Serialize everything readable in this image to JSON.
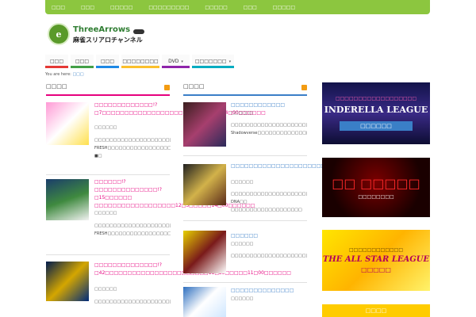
{
  "topnav": [
    "□□□",
    "□□□",
    "□□□□□",
    "□□□□□□□□□",
    "□□□□□",
    "□□□",
    "□□□□□"
  ],
  "logo": {
    "mark": "e",
    "name": "ThreeArrows",
    "sub": "麻雀スリアロチャンネル"
  },
  "mainnav": [
    {
      "label": "□□□",
      "color": "#e53935"
    },
    {
      "label": "□□□",
      "color": "#43a047"
    },
    {
      "label": "□□□",
      "color": "#1e88e5"
    },
    {
      "label": "□□□□□□□□",
      "color": "#fbc02d"
    },
    {
      "label": "DVD",
      "color": "#8e24aa",
      "caret": "▾"
    },
    {
      "label": "□□□□□□□",
      "color": "#00acc1",
      "caret": "▾"
    }
  ],
  "breadcrumb": {
    "prefix": "You are here:",
    "current": "□□□"
  },
  "colors": {
    "pink": "#e6007e",
    "blue": "#3a7fc7",
    "green": "#8cc63f",
    "rss": "#f39c12"
  },
  "left_column": {
    "heading": "□□□□",
    "posts": [
      {
        "title": "□□□□□□□□□□□□□!?□7□□□□□□□□□□□□□□□□□□□12□16□□□□14□00□□□□□□",
        "date": "□□□□□□",
        "excerpt": "□□□□□□□□□□□□□□□□□□□□□□□□□□□□□□□□□□□□□□□□□□□□□□□□□□□□□□□□□□□□□□ FRESH□□□□□□□□□□□□□□□□□□□□□□ ■□"
      },
      {
        "title": "□□□□□□!?□□□□□□□□□□□□□□!?□15□□□□□□ □□□□□□□□□□□□□□□□□□12□3□□□□□14□00□□□□□□",
        "date": "□□□□□□",
        "excerpt": "□□□□□□□□□□□□□□□□□□□□□□□□□□□□□□□□□□□□□□□□□□□□□□□□□□□□□□□□□□ FRESH□□□□□□□□□□□□□□□□□□"
      },
      {
        "title": "□□□□□□□□□□□□□□!?□42□□□□□□□□□□□□□□□□□□□□□□□11□23□□□□□11□00□□□□□□",
        "date": "□□□□□□",
        "excerpt": "□□□□□□□□□□□□□□□□□□□□□□□□□□□□□□□□□□□□□□□□□□□"
      }
    ]
  },
  "mid_column": {
    "heading": "□□□□",
    "posts": [
      {
        "title": "□□□□□□□□□□□□",
        "date": "□□□□□□",
        "excerpt": "□□□□□□□□□□□□□□□□□□□□□□□□□□□□□ Shadowverse□□□□□□□□□□□□□□□□□□□□□□□□□□□□□□□□□□□□□□□Shadowverse□□□□"
      },
      {
        "title": "□□□□□□□□□□□□□□□□□□□□□□□□□□□",
        "date": "□□□□□□",
        "excerpt": "□□□□□□□□□□□□□□□□□□□□□□□□□□□□□□□□□□□□□□□□□□□ DNA□□ □□□□□□□□□□□□□□□□□□□"
      },
      {
        "title": "□□□□□□",
        "date": "□□□□□□",
        "excerpt": "□□□□□□□□□□□□□□□□□□□□□□□□□□□□□□□□□□□□□□□□□□□□□□□□□□□□"
      },
      {
        "title": "□□□□□□□□□□□□□□",
        "date": "□□□□□□",
        "excerpt": ""
      }
    ]
  },
  "banners": [
    {
      "title": "INDERELLA LEAGUE",
      "sub": "□□□□□□□□□□□□□□□□□□",
      "cta": "□□□□□□",
      "bg": "#1a1a5e",
      "fg": "#ffffff"
    },
    {
      "title": "□□ □□□□□",
      "sub": "□□□□□□□□",
      "cta": "",
      "bg": "#3a0000",
      "fg": "#ff3333"
    },
    {
      "title": "THE ALL STAR LEAGUE",
      "sub": "□□□□□□□□□□□□",
      "cta": "□□□□□",
      "bg": "#f5d800",
      "fg": "#b3005a"
    },
    {
      "title": "□□□□",
      "sub": "",
      "cta": "",
      "bg": "#ffcc00",
      "fg": "#ffffff"
    }
  ]
}
